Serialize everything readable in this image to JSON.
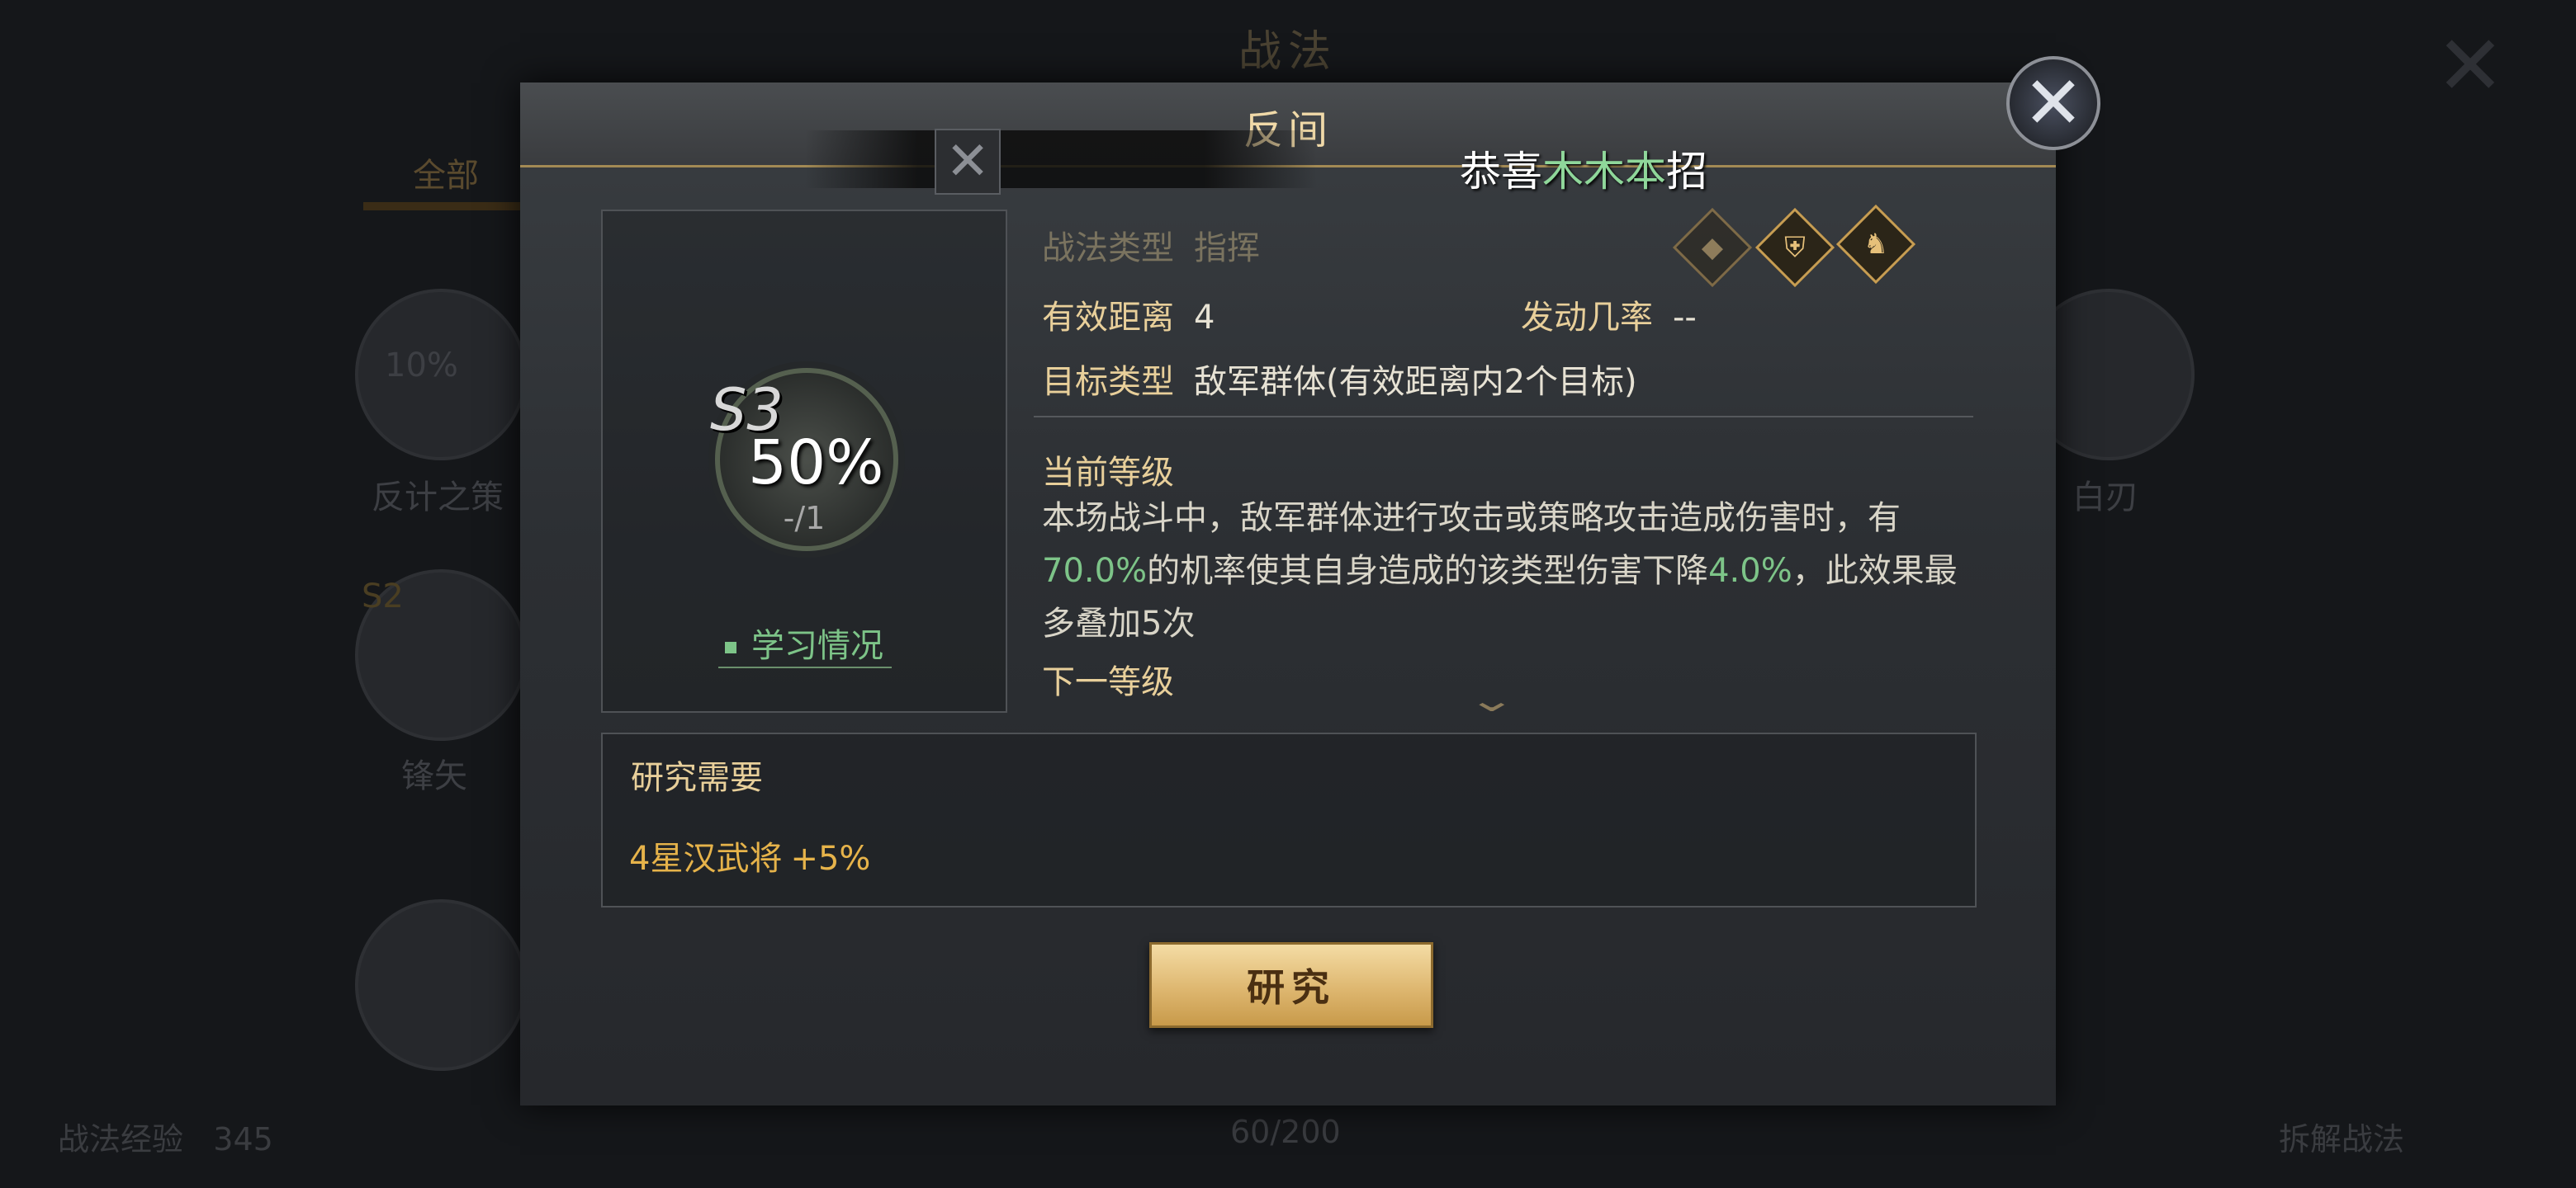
{
  "background": {
    "title": "战法",
    "tab_all": "全部",
    "cards": [
      {
        "percent": "10%",
        "label": "反计之策"
      },
      {
        "grade": "S2",
        "label": "锋矢"
      },
      {
        "label": "白刃"
      }
    ],
    "bottom_left_label": "战法经验",
    "bottom_left_value": "345",
    "bottom_mid": "60/200",
    "bottom_right": "拆解战法"
  },
  "modal": {
    "title": "反间",
    "skill": {
      "grade": "S3",
      "percent": "50%",
      "count": "-/1",
      "learn_status": "学习情况"
    },
    "info": {
      "type_label": "战法类型",
      "type_value": "指挥",
      "range_label": "有效距离",
      "range_value": "4",
      "rate_label": "发动几率",
      "rate_value": "--",
      "target_label": "目标类型",
      "target_value": "敌军群体(有效距离内2个目标)"
    },
    "icons": [
      "shield-icon",
      "horse-icon",
      "diamond-icon"
    ],
    "toast": {
      "prefix": "恭喜",
      "name": "木木本",
      "suffix": "招"
    },
    "current_level_heading": "当前等级",
    "description": {
      "part1": "本场战斗中，敌军群体进行攻击或策略攻击造成伤害时，有",
      "rate": "70.0%",
      "part2": "的机率使其自身造成的该类型伤害下降",
      "reduction": "4.0%",
      "part3": "，此效果最多叠加5次"
    },
    "next_level_heading": "下一等级",
    "research": {
      "title": "研究需要",
      "requirement": "4星汉武将",
      "bonus": "+5%"
    },
    "research_button": "研究"
  }
}
